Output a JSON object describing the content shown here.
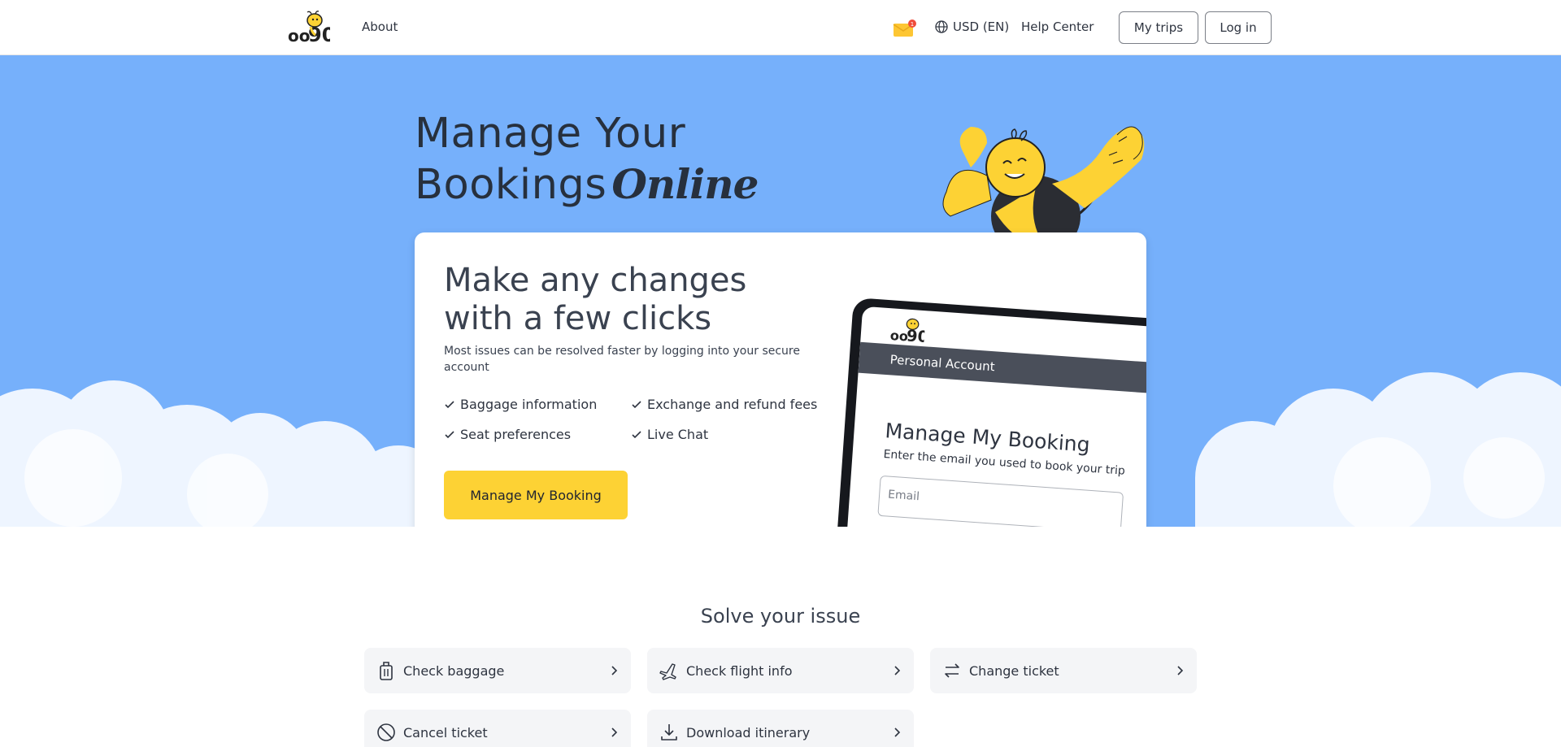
{
  "header": {
    "about": "About",
    "currency": "USD (EN)",
    "help": "Help Center",
    "my_trips": "My trips",
    "log_in": "Log in",
    "mail_badge": "1"
  },
  "hero": {
    "title_line1": "Manage Your",
    "title_line2": "Bookings",
    "title_script": "Online"
  },
  "card": {
    "title": "Make any changes with a few clicks",
    "subtitle": "Most issues can be resolved faster by logging into your secure account",
    "features": [
      "Baggage information",
      "Exchange and refund fees",
      "Seat preferences",
      "Live Chat"
    ],
    "button": "Manage My Booking"
  },
  "tablet": {
    "bar": "Personal Account",
    "title": "Manage My Booking",
    "subtitle": "Enter the email you used to book your trip",
    "email_placeholder": "Email"
  },
  "solve": {
    "title": "Solve your issue",
    "tiles": [
      {
        "label": "Check baggage",
        "icon": "baggage-icon"
      },
      {
        "label": "Check flight info",
        "icon": "plane-icon"
      },
      {
        "label": "Change ticket",
        "icon": "swap-icon"
      },
      {
        "label": "Cancel ticket",
        "icon": "cancel-icon"
      },
      {
        "label": "Download itinerary",
        "icon": "download-icon"
      }
    ]
  },
  "colors": {
    "sky": "#76b0fb",
    "accent_yellow": "#fdd234",
    "text": "#2e3440"
  }
}
